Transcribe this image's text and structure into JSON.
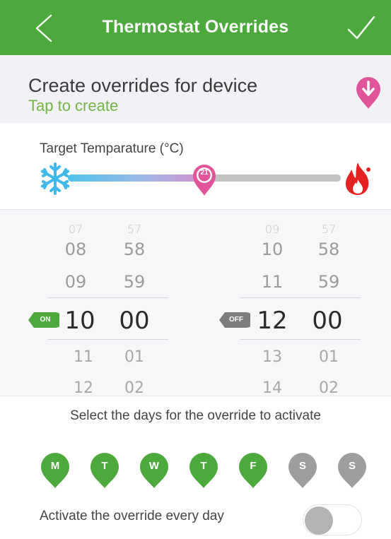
{
  "header": {
    "title": "Thermostat Overrides",
    "back_icon": "chevron-left-icon",
    "confirm_icon": "checkmark-icon"
  },
  "create": {
    "title": "Create overrides for device",
    "subtitle": "Tap to create",
    "icon": "download-pin-icon"
  },
  "temperature": {
    "label": "Target Temparature (°C)",
    "value": "21",
    "value_fraction": 0.5,
    "cold_icon": "snowflake-icon",
    "hot_icon": "flame-icon"
  },
  "start_time": {
    "state_label": "ON",
    "hours": [
      "07",
      "08",
      "09",
      "10",
      "11",
      "12"
    ],
    "minutes": [
      "57",
      "58",
      "59",
      "00",
      "01",
      "02"
    ],
    "selected_hour": "10",
    "selected_minute": "00"
  },
  "end_time": {
    "state_label": "OFF",
    "hours": [
      "09",
      "10",
      "11",
      "12",
      "13",
      "14"
    ],
    "minutes": [
      "57",
      "58",
      "59",
      "00",
      "01",
      "02"
    ],
    "selected_hour": "12",
    "selected_minute": "00"
  },
  "days": {
    "label": "Select the days for the override to activate",
    "items": [
      {
        "letter": "M",
        "active": true
      },
      {
        "letter": "T",
        "active": true
      },
      {
        "letter": "W",
        "active": true
      },
      {
        "letter": "T",
        "active": true
      },
      {
        "letter": "F",
        "active": true
      },
      {
        "letter": "S",
        "active": false
      },
      {
        "letter": "S",
        "active": false
      }
    ]
  },
  "every_day": {
    "label": "Activate the override every day",
    "enabled": false
  },
  "colors": {
    "primary_green": "#4ca93c",
    "accent_pink": "#e0559a",
    "inactive_grey": "#9e9e9e",
    "cold_blue": "#4dc3ee",
    "hot_red": "#e52222"
  }
}
